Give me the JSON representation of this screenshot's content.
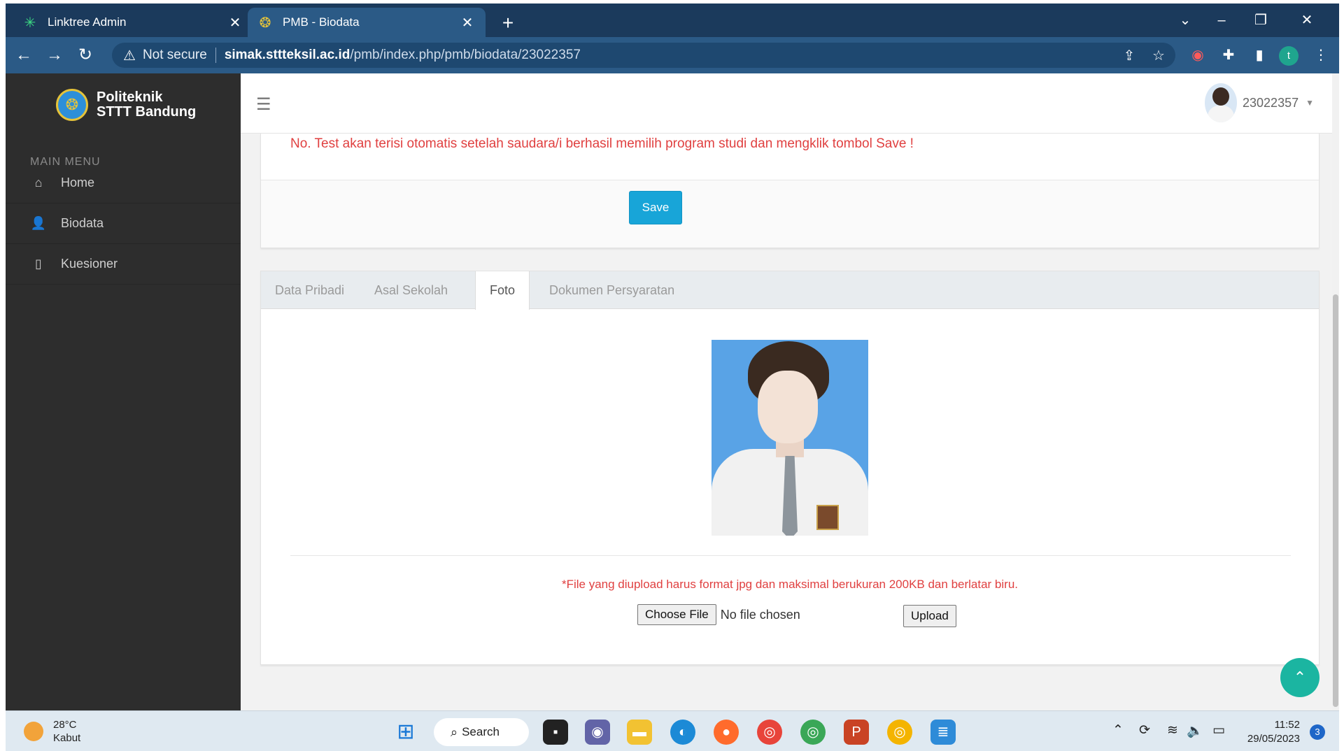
{
  "browser": {
    "tabs": [
      {
        "title": "Linktree Admin",
        "icon": "linktree-icon"
      },
      {
        "title": "PMB - Biodata",
        "icon": "stt-favicon"
      }
    ],
    "address": {
      "security_label": "Not secure",
      "domain": "simak.sttteksil.ac.id",
      "path": "/pmb/index.php/pmb/biodata/23022357"
    },
    "profile_initial": "t"
  },
  "sidebar": {
    "brand_line1": "Politeknik",
    "brand_line2": "STTT Bandung",
    "menu_title": "MAIN MENU",
    "items": [
      {
        "label": "Home",
        "icon": "home-icon"
      },
      {
        "label": "Biodata",
        "icon": "user-icon"
      },
      {
        "label": "Kuesioner",
        "icon": "document-icon"
      }
    ]
  },
  "header": {
    "username": "23022357"
  },
  "main": {
    "notice": "No. Test akan terisi otomatis setelah saudara/i berhasil memilih program studi dan mengklik tombol Save !",
    "save_label": "Save",
    "tabs": [
      {
        "label": "Data Pribadi",
        "active": false
      },
      {
        "label": "Asal Sekolah",
        "active": false
      },
      {
        "label": "Foto",
        "active": true
      },
      {
        "label": "Dokumen Persyaratan",
        "active": false
      }
    ],
    "upload_note": "*File yang diupload harus format jpg dan maksimal berukuran 200KB dan berlatar biru.",
    "choose_file_label": "Choose File",
    "no_file_text": "No file chosen",
    "upload_label": "Upload"
  },
  "taskbar": {
    "temperature": "28°C",
    "weather": "Kabut",
    "search_label": "Search",
    "time": "11:52",
    "date": "29/05/2023",
    "notifications": "3"
  },
  "colors": {
    "accent": "#18a5d8",
    "danger_text": "#e04040",
    "sidebar_bg": "#2d2d2d",
    "browser_frame": "#2b5a86"
  }
}
